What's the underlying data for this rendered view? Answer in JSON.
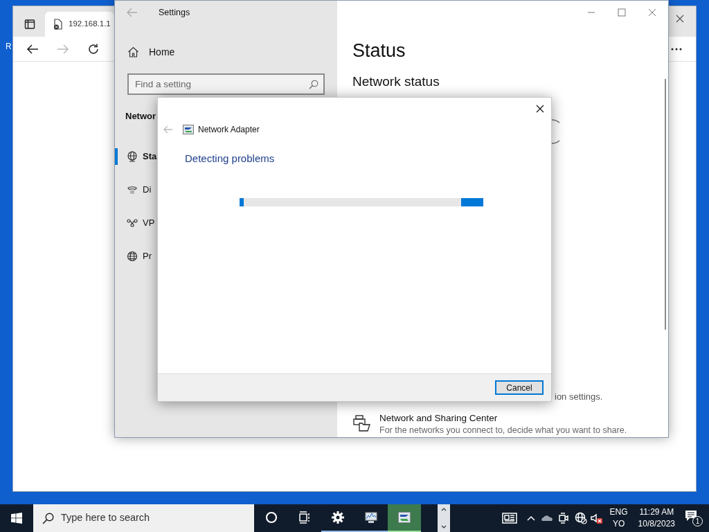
{
  "desktop_icon_labels": [
    "R"
  ],
  "browser": {
    "tab_title": "192.168.1.1"
  },
  "settings": {
    "title": "Settings",
    "home": "Home",
    "search": {
      "placeholder": "Find a setting"
    },
    "section_heading": "Networ",
    "nav": [
      {
        "kind": "status",
        "label": "Sta",
        "selected": true
      },
      {
        "kind": "dialup",
        "label": "Di",
        "selected": false
      },
      {
        "kind": "vpn",
        "label": "VP",
        "selected": false
      },
      {
        "kind": "proxy",
        "label": "Pr",
        "selected": false
      }
    ],
    "page_title": "Status",
    "network_status_heading": "Network status",
    "partial_text": "ion settings.",
    "links": [
      {
        "kind": "sharing-center",
        "title": "Network and Sharing Center",
        "description": "For the networks you connect to, decide what you want to share."
      }
    ]
  },
  "dialog": {
    "title": "Network Adapter",
    "heading": "Detecting problems",
    "progress": {
      "level": 0.09
    },
    "cancel": "Cancel"
  },
  "taskbar": {
    "search_placeholder": "Type here to search",
    "apps": [
      {
        "kind": "cortana",
        "running": false,
        "selected": false
      },
      {
        "kind": "task-view",
        "running": false,
        "selected": false
      },
      {
        "kind": "settings",
        "running": true,
        "selected": false
      },
      {
        "kind": "monitor",
        "running": true,
        "selected": false
      },
      {
        "kind": "network-adapter",
        "running": true,
        "selected": true
      }
    ],
    "language": [
      "ENG",
      "YO"
    ],
    "time": "11:29 AM",
    "date": "10/8/2023",
    "notification_count": "1"
  }
}
